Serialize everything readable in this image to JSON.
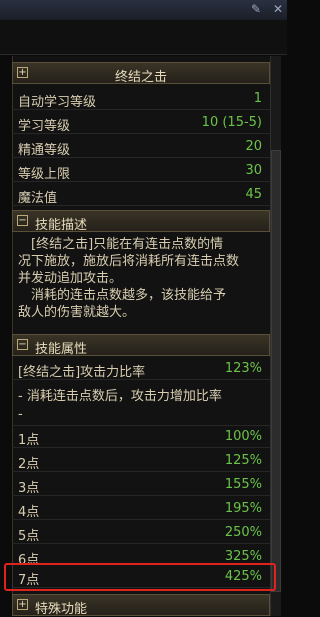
{
  "window": {
    "icons": [
      "pin-icon",
      "close-icon"
    ]
  },
  "skill": {
    "name": "终结之击"
  },
  "stats": [
    {
      "label": "自动学习等级",
      "value": "1"
    },
    {
      "label": "学习等级",
      "value": "10 (15-5)"
    },
    {
      "label": "精通等级",
      "value": "20"
    },
    {
      "label": "等级上限",
      "value": "30"
    },
    {
      "label": "魔法值",
      "value": "45"
    }
  ],
  "description": {
    "header": "技能描述",
    "lines": [
      "　[终结之击]只能在有连击点数的情",
      "况下施放，施放后将消耗所有连击点数",
      "并发动追加攻击。",
      "　消耗的连击点数越多，该技能给予",
      "敌人的伤害就越大。"
    ]
  },
  "attributes": {
    "header": "技能属性",
    "ratio_label": "[终结之击]攻击力比率",
    "ratio_value": "123%",
    "note": "- 消耗连击点数后，攻击力增加比率",
    "note2": "-",
    "points": [
      {
        "label": "1点",
        "value": "100%"
      },
      {
        "label": "2点",
        "value": "125%"
      },
      {
        "label": "3点",
        "value": "155%"
      },
      {
        "label": "4点",
        "value": "195%"
      },
      {
        "label": "5点",
        "value": "250%"
      },
      {
        "label": "6点",
        "value": "325%"
      },
      {
        "label": "7点",
        "value": "425%"
      }
    ]
  },
  "special": {
    "header": "特殊功能"
  }
}
